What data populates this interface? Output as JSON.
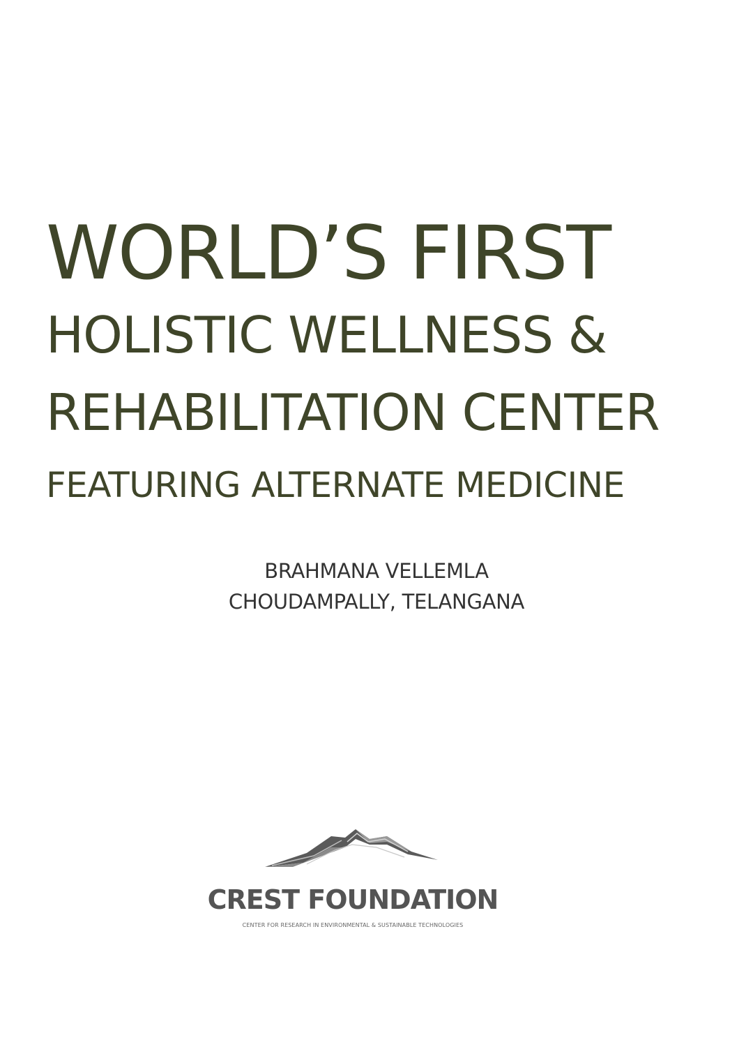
{
  "title": {
    "line1": "WORLD’S FIRST",
    "line2": "HOLISTIC WELLNESS &",
    "line3": "REHABILITATION CENTER",
    "line4": "FEATURING ALTERNATE MEDICINE"
  },
  "location": {
    "line1": "BRAHMANA VELLEMLA",
    "line2": "CHOUDAMPALLY, TELANGANA"
  },
  "logo": {
    "icon": "mountains-logo-icon",
    "name": "CREST FOUNDATION",
    "tagline": "CENTER FOR RESEARCH IN ENVIRONMENTAL & SUSTAINABLE TECHNOLOGIES"
  },
  "colors": {
    "headline": "#3f4529",
    "location": "#333333",
    "logo": "#545454"
  }
}
